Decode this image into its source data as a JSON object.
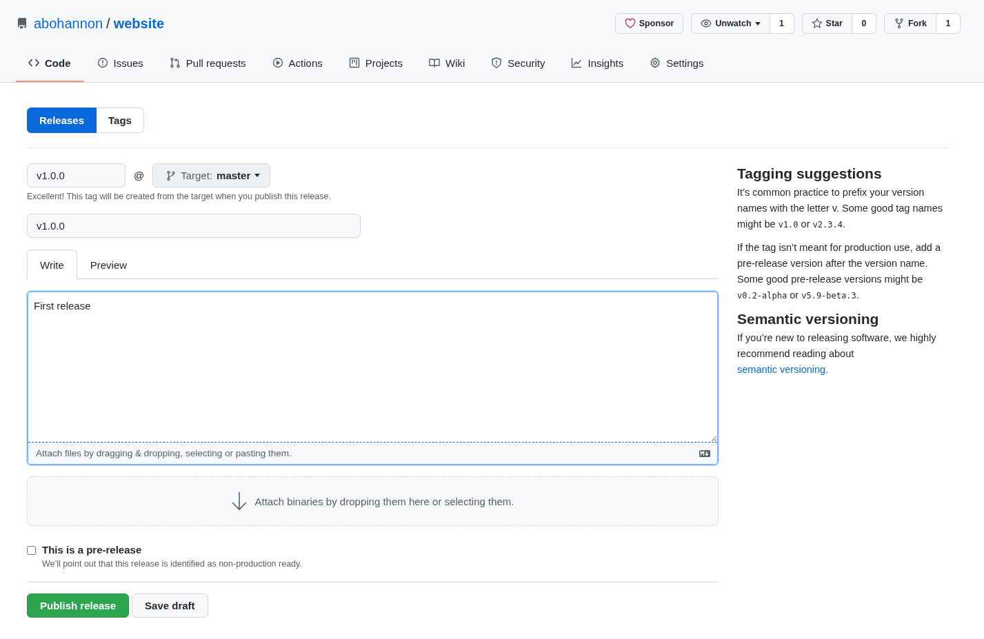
{
  "repo": {
    "owner": "abohannon",
    "separator": "/",
    "name": "website"
  },
  "repo_actions": [
    {
      "kind": "sponsor",
      "label": "Sponsor"
    },
    {
      "kind": "watch",
      "label": "Unwatch",
      "count": "1"
    },
    {
      "kind": "star",
      "label": "Star",
      "count": "0"
    },
    {
      "kind": "fork",
      "label": "Fork",
      "count": "1"
    }
  ],
  "tabs": [
    {
      "label": "Code",
      "selected": true
    },
    {
      "label": "Issues",
      "selected": false
    },
    {
      "label": "Pull requests",
      "selected": false
    },
    {
      "label": "Actions",
      "selected": false
    },
    {
      "label": "Projects",
      "selected": false
    },
    {
      "label": "Wiki",
      "selected": false
    },
    {
      "label": "Security",
      "selected": false
    },
    {
      "label": "Insights",
      "selected": false
    },
    {
      "label": "Settings",
      "selected": false
    }
  ],
  "subnav": [
    {
      "label": "Releases",
      "selected": true
    },
    {
      "label": "Tags",
      "selected": false
    }
  ],
  "tag_field": {
    "value": "v1.0.0"
  },
  "at_sign": "@",
  "target": {
    "label": "Target:",
    "value": "master"
  },
  "tag_hint": "Excellent! This tag will be created from the target when you publish this release.",
  "title_field": {
    "value": "v1.0.0"
  },
  "editor_tabs": [
    {
      "label": "Write",
      "selected": true
    },
    {
      "label": "Preview",
      "selected": false
    }
  ],
  "editor": {
    "value": "First release",
    "footer": "Attach files by dragging & dropping, selecting or pasting them."
  },
  "attach_binaries": "Attach binaries by dropping them here or selecting them.",
  "prerelease": {
    "label": "This is a pre-release",
    "hint": "We’ll point out that this release is identified as non-production ready.",
    "checked": false
  },
  "buttons": [
    {
      "kind": "primary",
      "label": "Publish release"
    },
    {
      "kind": "secondary",
      "label": "Save draft"
    }
  ],
  "sidebar": [
    {
      "heading": "Tagging suggestions",
      "paragraphs": [
        [
          {
            "kind": "text",
            "text": "It’s common practice to prefix your version names with the letter v. Some good tag names might be "
          },
          {
            "kind": "code",
            "text": "v1.0"
          },
          {
            "kind": "text",
            "text": " or "
          },
          {
            "kind": "code",
            "text": "v2.3.4"
          },
          {
            "kind": "text",
            "text": "."
          }
        ],
        [
          {
            "kind": "text",
            "text": "If the tag isn’t meant for production use, add a pre-release version after the version name. Some good pre-release versions might be "
          },
          {
            "kind": "code",
            "text": "v0.2-alpha"
          },
          {
            "kind": "text",
            "text": " or "
          },
          {
            "kind": "code",
            "text": "v5.9-beta.3"
          },
          {
            "kind": "text",
            "text": "."
          }
        ]
      ]
    },
    {
      "heading": "Semantic versioning",
      "paragraphs": [
        [
          {
            "kind": "text",
            "text": "If you’re new to releasing software, we highly recommend reading about "
          },
          {
            "kind": "link",
            "text": "semantic versioning."
          }
        ]
      ]
    }
  ]
}
